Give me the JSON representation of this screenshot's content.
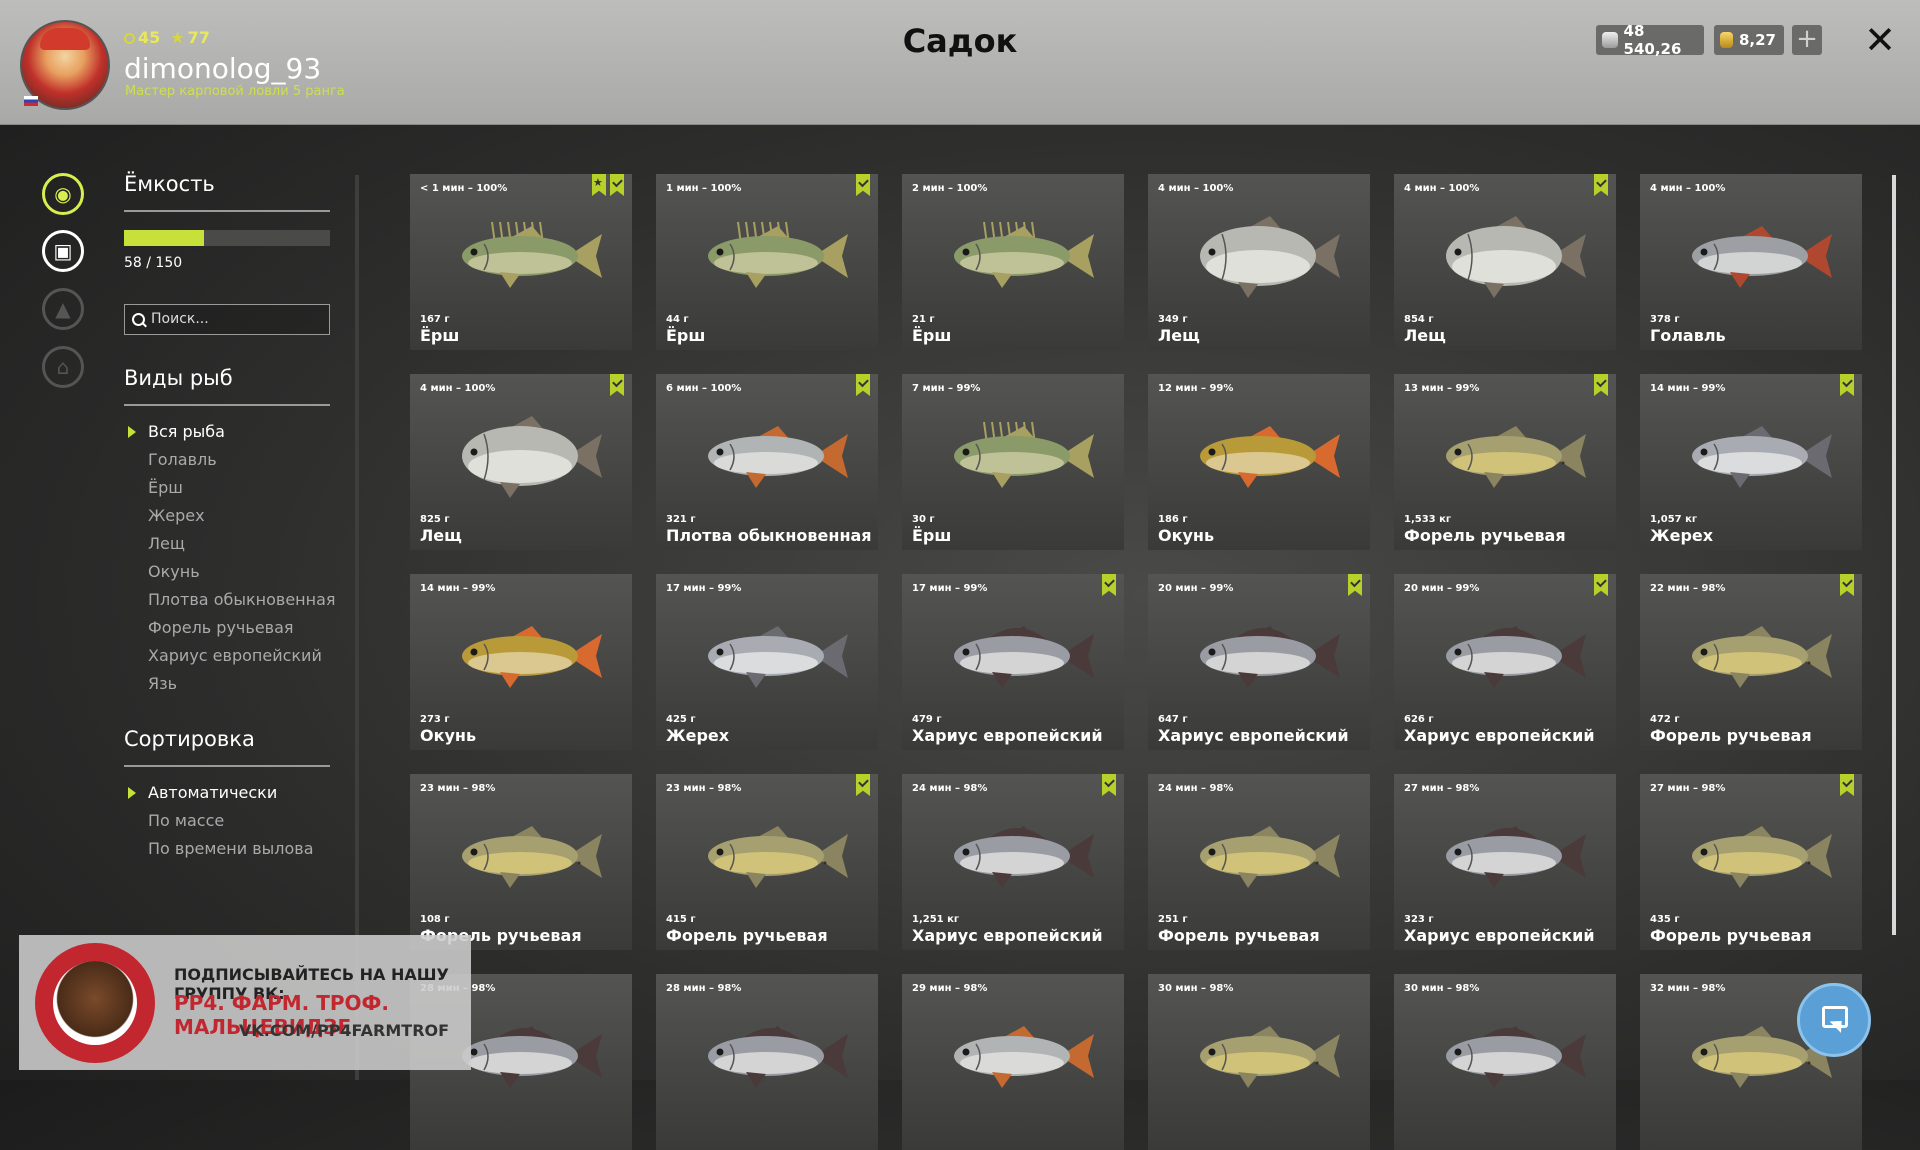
{
  "header": {
    "title": "Садок",
    "player": {
      "stat_a": "45",
      "stat_b": "77",
      "username": "dimonolog_93",
      "rank": "Мастер карповой ловли 5 ранга"
    },
    "currency": {
      "silver": "48 540,26",
      "gold": "8,27"
    }
  },
  "capacity": {
    "title": "Ёмкость",
    "text": "58 / 150",
    "fraction": 0.387
  },
  "search": {
    "placeholder": "Поиск..."
  },
  "species": {
    "title": "Виды рыб",
    "items": [
      "Вся рыба",
      "Голавль",
      "Ёрш",
      "Жерех",
      "Лещ",
      "Окунь",
      "Плотва обыкновенная",
      "Форель ручьевая",
      "Хариус европейский",
      "Язь"
    ]
  },
  "sort": {
    "title": "Сортировка",
    "items": [
      "Автоматически",
      "По массе",
      "По времени вылова"
    ]
  },
  "cards": [
    {
      "time": "< 1 мин – 100%",
      "weight": "167 г",
      "name": "Ёрш",
      "kind": "ruff",
      "marks": [
        "check",
        "star"
      ]
    },
    {
      "time": "1 мин – 100%",
      "weight": "44 г",
      "name": "Ёрш",
      "kind": "ruff",
      "marks": [
        "check"
      ]
    },
    {
      "time": "2 мин – 100%",
      "weight": "21 г",
      "name": "Ёрш",
      "kind": "ruff",
      "marks": []
    },
    {
      "time": "4 мин – 100%",
      "weight": "349 г",
      "name": "Лещ",
      "kind": "bream",
      "marks": []
    },
    {
      "time": "4 мин – 100%",
      "weight": "854 г",
      "name": "Лещ",
      "kind": "bream",
      "marks": [
        "check"
      ]
    },
    {
      "time": "4 мин – 100%",
      "weight": "378 г",
      "name": "Голавль",
      "kind": "chub",
      "marks": []
    },
    {
      "time": "4 мин – 100%",
      "weight": "825 г",
      "name": "Лещ",
      "kind": "bream",
      "marks": [
        "check"
      ]
    },
    {
      "time": "6 мин – 100%",
      "weight": "321 г",
      "name": "Плотва обыкновенная",
      "kind": "roach",
      "marks": [
        "check"
      ]
    },
    {
      "time": "7 мин – 99%",
      "weight": "30 г",
      "name": "Ёрш",
      "kind": "ruff",
      "marks": []
    },
    {
      "time": "12 мин – 99%",
      "weight": "186 г",
      "name": "Окунь",
      "kind": "perch",
      "marks": []
    },
    {
      "time": "13 мин – 99%",
      "weight": "1,533 кг",
      "name": "Форель ручьевая",
      "kind": "trout",
      "marks": [
        "check"
      ]
    },
    {
      "time": "14 мин – 99%",
      "weight": "1,057 кг",
      "name": "Жерех",
      "kind": "asp",
      "marks": [
        "check"
      ]
    },
    {
      "time": "14 мин – 99%",
      "weight": "273 г",
      "name": "Окунь",
      "kind": "perch",
      "marks": []
    },
    {
      "time": "17 мин – 99%",
      "weight": "425 г",
      "name": "Жерех",
      "kind": "asp",
      "marks": []
    },
    {
      "time": "17 мин – 99%",
      "weight": "479 г",
      "name": "Хариус европейский",
      "kind": "grayling",
      "marks": [
        "check"
      ]
    },
    {
      "time": "20 мин – 99%",
      "weight": "647 г",
      "name": "Хариус европейский",
      "kind": "grayling",
      "marks": [
        "check"
      ]
    },
    {
      "time": "20 мин – 99%",
      "weight": "626 г",
      "name": "Хариус европейский",
      "kind": "grayling",
      "marks": [
        "check"
      ]
    },
    {
      "time": "22 мин – 98%",
      "weight": "472 г",
      "name": "Форель ручьевая",
      "kind": "trout",
      "marks": [
        "check"
      ]
    },
    {
      "time": "23 мин – 98%",
      "weight": "108 г",
      "name": "Форель ручьевая",
      "kind": "trout",
      "marks": []
    },
    {
      "time": "23 мин – 98%",
      "weight": "415 г",
      "name": "Форель ручьевая",
      "kind": "trout",
      "marks": [
        "check"
      ]
    },
    {
      "time": "24 мин – 98%",
      "weight": "1,251 кг",
      "name": "Хариус европейский",
      "kind": "grayling",
      "marks": [
        "check"
      ]
    },
    {
      "time": "24 мин – 98%",
      "weight": "251 г",
      "name": "Форель ручьевая",
      "kind": "trout",
      "marks": []
    },
    {
      "time": "27 мин – 98%",
      "weight": "323 г",
      "name": "Хариус европейский",
      "kind": "grayling",
      "marks": []
    },
    {
      "time": "27 мин – 98%",
      "weight": "435 г",
      "name": "Форель ручьевая",
      "kind": "trout",
      "marks": [
        "check"
      ]
    },
    {
      "time": "28 мин – 98%",
      "weight": "",
      "name": "",
      "kind": "grayling",
      "marks": []
    },
    {
      "time": "28 мин – 98%",
      "weight": "",
      "name": "",
      "kind": "grayling",
      "marks": []
    },
    {
      "time": "29 мин – 98%",
      "weight": "",
      "name": "",
      "kind": "roach",
      "marks": []
    },
    {
      "time": "30 мин – 98%",
      "weight": "",
      "name": "",
      "kind": "trout",
      "marks": []
    },
    {
      "time": "30 мин – 98%",
      "weight": "",
      "name": "",
      "kind": "grayling",
      "marks": []
    },
    {
      "time": "32 мин – 98%",
      "weight": "",
      "name": "",
      "kind": "trout",
      "marks": []
    }
  ],
  "banner": {
    "line1": "ПОДПИСЫВАЙТЕСЬ НА НАШУ ГРУППУ ВК:",
    "line2": "РР4. ФАРМ. ТРОФ. МАЛЬЦЕВИДЗЕ",
    "line3": "VK.COM/PP4FARMTROF"
  },
  "icons": {
    "fish_tab": "fish-icon",
    "keepnet_tab": "keepnet-icon",
    "upgrade_tab": "upgrade-icon",
    "home_tab": "home-icon",
    "help": "cursor-help-icon"
  },
  "colors": {
    "accent": "#c8e03a",
    "header_bg": "#b3b3b1",
    "card_bg": "#4a4a48"
  }
}
